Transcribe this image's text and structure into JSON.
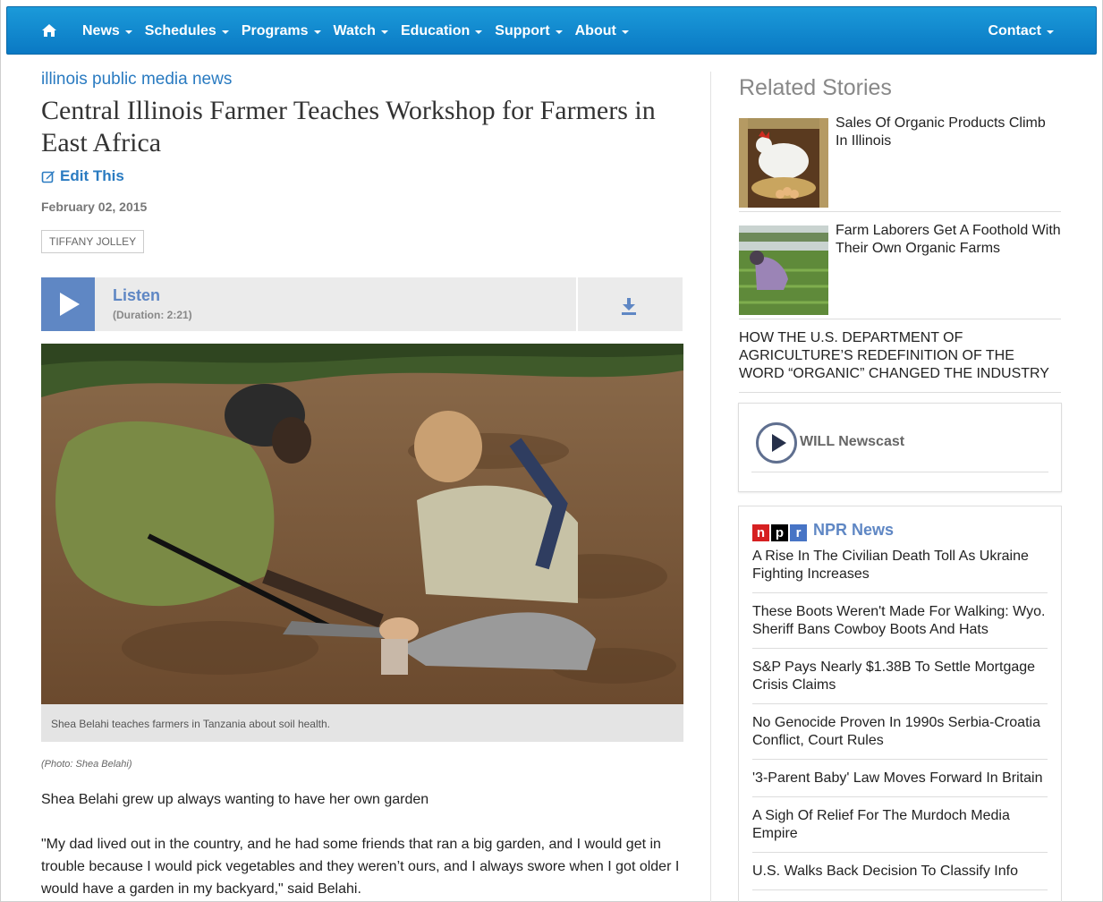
{
  "nav": {
    "home_icon": "home-icon",
    "items": [
      {
        "label": "News"
      },
      {
        "label": "Schedules"
      },
      {
        "label": "Programs"
      },
      {
        "label": "Watch"
      },
      {
        "label": "Education"
      },
      {
        "label": "Support"
      },
      {
        "label": "About"
      }
    ],
    "contact": "Contact",
    "bg_color": "#0a79c4"
  },
  "article": {
    "kicker": "illinois public media news",
    "headline": "Central Illinois Farmer Teaches Workshop for Farmers in East Africa",
    "edit_label": "Edit This",
    "date": "February 02, 2015",
    "author": "TIFFANY JOLLEY",
    "player": {
      "listen_label": "Listen",
      "duration": "(Duration: 2:21)"
    },
    "photo_caption": "Shea Belahi teaches farmers in Tanzania about soil health.",
    "photo_credit": "(Photo: Shea Belahi)",
    "paragraphs": [
      "Shea Belahi grew up always wanting to have her own garden",
      "\"My dad lived out in the country, and he had some friends that ran a big garden, and I would get in trouble because I would pick vegetables and they weren’t ours, and I always swore when I got older I would have a garden in my backyard,\" said Belahi."
    ]
  },
  "sidebar": {
    "related_title": "Related Stories",
    "stories": [
      {
        "title": "Sales Of Organic Products Climb In Illinois"
      },
      {
        "title": "Farm Laborers Get A Foothold With Their Own Organic Farms"
      },
      {
        "title": "HOW THE U.S. DEPARTMENT OF AGRICULTURE’S REDEFINITION OF THE WORD “ORGANIC” CHANGED THE INDUSTRY"
      }
    ],
    "newscast_label": "WILL Newscast",
    "npr": {
      "logo_letters": [
        "n",
        "p",
        "r"
      ],
      "logo_colors": [
        "#d62021",
        "#000000",
        "#4774c5"
      ],
      "title": "NPR News",
      "items": [
        "A Rise In The Civilian Death Toll As Ukraine Fighting Increases",
        "These Boots Weren't Made For Walking: Wyo. Sheriff Bans Cowboy Boots And Hats",
        "S&P Pays Nearly $1.38B To Settle Mortgage Crisis Claims",
        "No Genocide Proven In 1990s Serbia-Croatia Conflict, Court Rules",
        "'3-Parent Baby' Law Moves Forward In Britain",
        "A Sigh Of Relief For The Murdoch Media Empire",
        "U.S. Walks Back Decision To Classify Info"
      ]
    }
  }
}
